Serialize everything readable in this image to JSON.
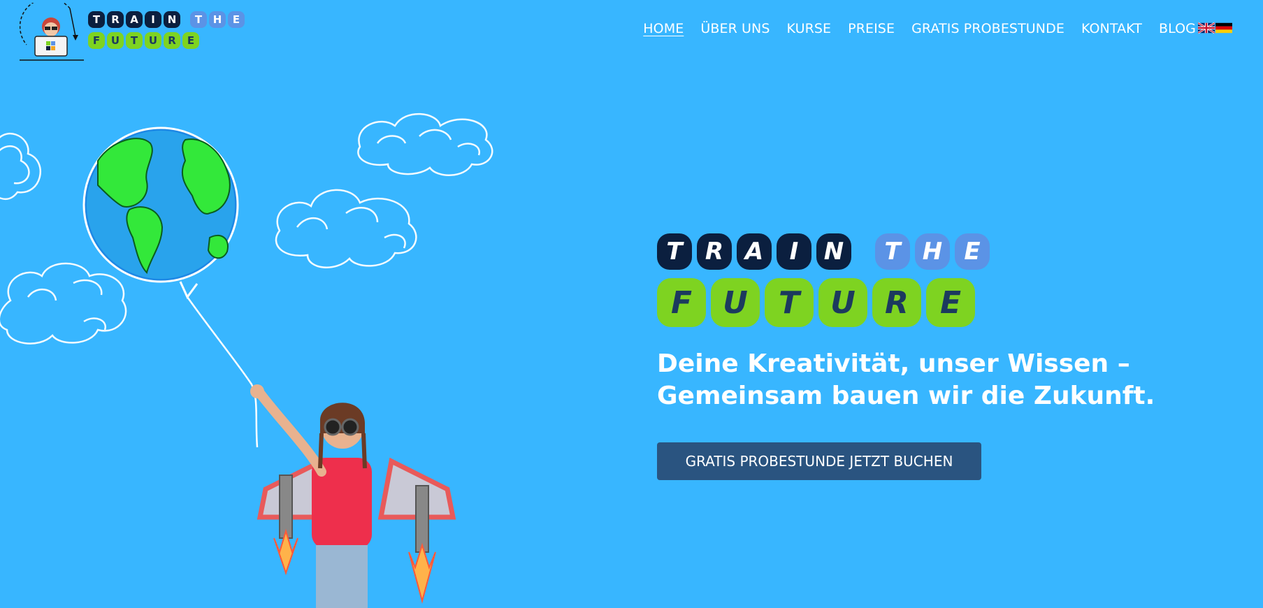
{
  "brand": {
    "logo_row1": [
      "T",
      "R",
      "A",
      "I",
      "N"
    ],
    "logo_row1b": [
      "T",
      "H",
      "E"
    ],
    "logo_row2": [
      "F",
      "U",
      "T",
      "U",
      "R",
      "E"
    ],
    "colors": {
      "background": "#38b6ff",
      "navy_tile": "#0b1f3f",
      "blue_tile": "#5b93e6",
      "green_tile": "#7ed321",
      "cta_background": "#2a5480"
    }
  },
  "nav": {
    "items": [
      {
        "label": "HOME",
        "active": true
      },
      {
        "label": "ÜBER UNS",
        "active": false
      },
      {
        "label": "KURSE",
        "active": false
      },
      {
        "label": "PREISE",
        "active": false
      },
      {
        "label": "GRATIS PROBESTUNDE",
        "active": false
      },
      {
        "label": "KONTAKT",
        "active": false
      },
      {
        "label": "BLOG",
        "active": false
      }
    ],
    "languages": [
      {
        "icon": "uk-flag-icon"
      },
      {
        "icon": "german-flag-icon"
      }
    ]
  },
  "hero": {
    "tagline_line1": "Deine Kreativität, unser Wissen –",
    "tagline_line2": "Gemeinsam bauen wir die Zukunft.",
    "cta_label": "GRATIS PROBESTUNDE JETZT BUCHEN",
    "illustration_icons": [
      "earth-balloon-icon",
      "cloud-icon",
      "jetpack-child-icon"
    ]
  }
}
